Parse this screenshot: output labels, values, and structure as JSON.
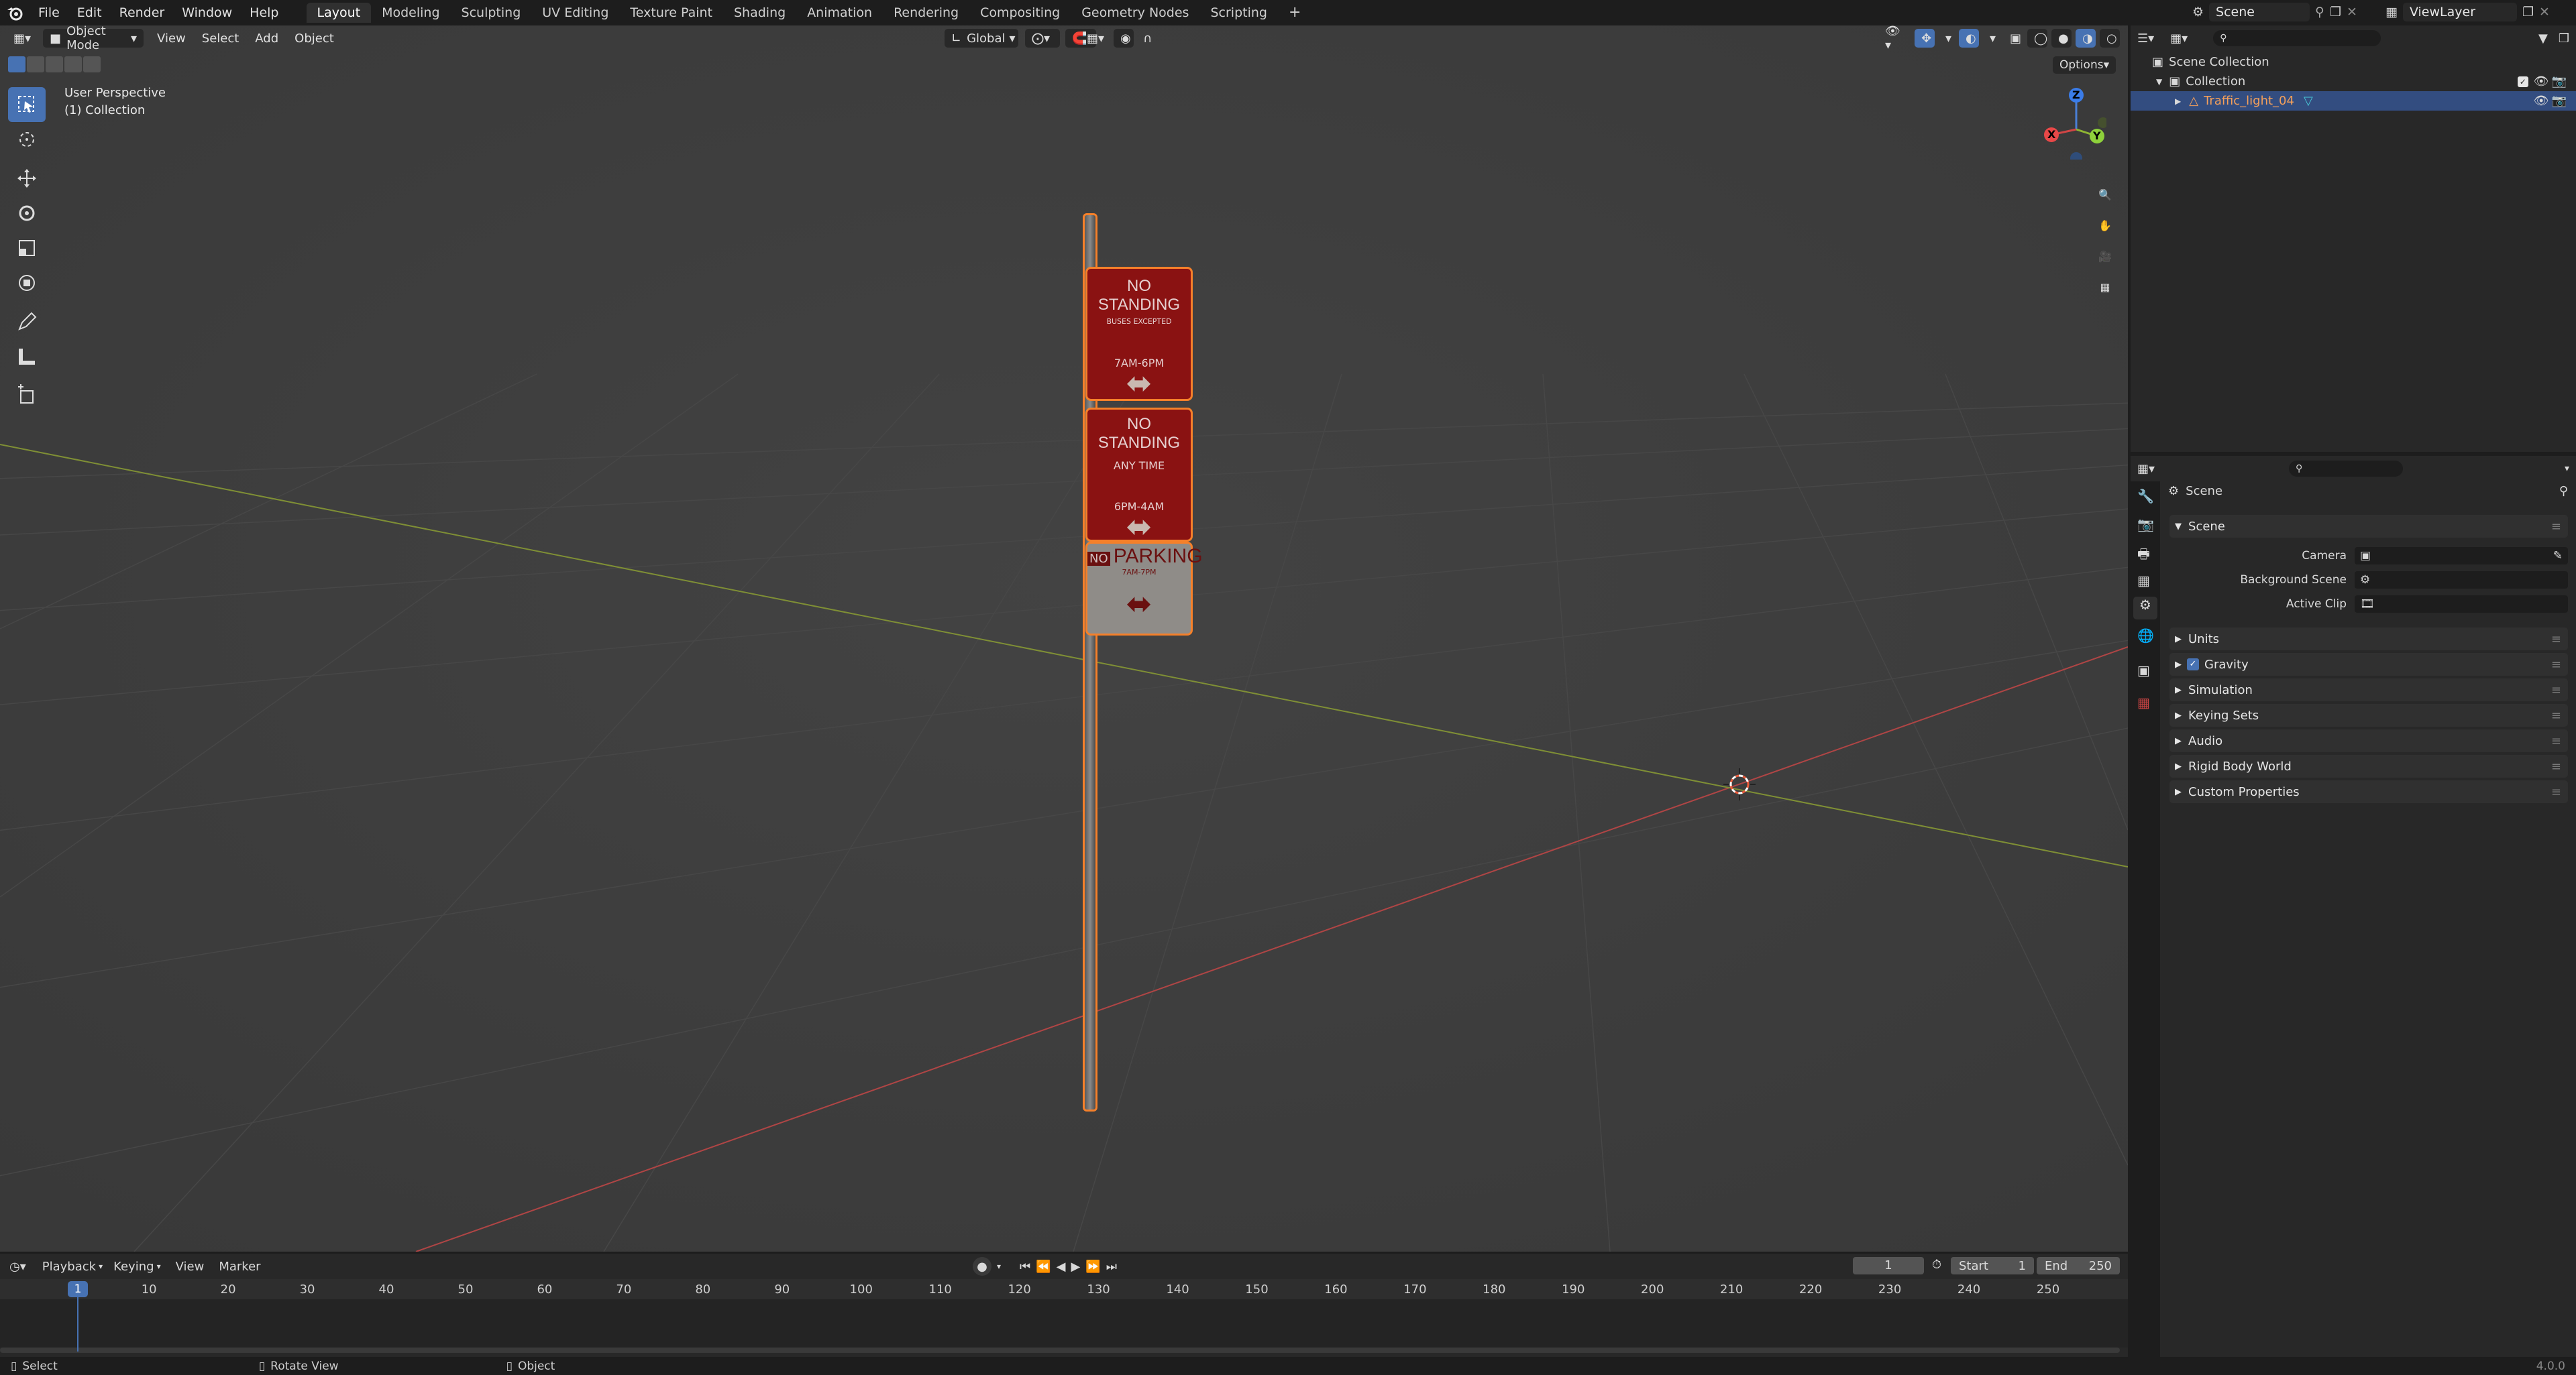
{
  "menu": [
    "File",
    "Edit",
    "Render",
    "Window",
    "Help"
  ],
  "workspaces": [
    "Layout",
    "Modeling",
    "Sculpting",
    "UV Editing",
    "Texture Paint",
    "Shading",
    "Animation",
    "Rendering",
    "Compositing",
    "Geometry Nodes",
    "Scripting"
  ],
  "active_workspace": "Layout",
  "scene_name": "Scene",
  "view_layer": "ViewLayer",
  "viewport": {
    "mode": "Object Mode",
    "menus": [
      "View",
      "Select",
      "Add",
      "Object"
    ],
    "orientation": "Global",
    "options_label": "Options",
    "overlay_line1": "User Perspective",
    "overlay_line2": "(1) Collection",
    "gizmo": {
      "x": "X",
      "y": "Y",
      "z": "Z"
    }
  },
  "signs": {
    "top": {
      "title": "NO STANDING",
      "sub": "BUSES EXCEPTED",
      "time": "7AM-6PM"
    },
    "mid": {
      "title": "NO STANDING",
      "sub": "ANY TIME",
      "time": "6PM-4AM"
    },
    "bottom": {
      "prefix": "NO",
      "title": "PARKING",
      "sub": "7AM-7PM"
    }
  },
  "outliner": {
    "root": "Scene Collection",
    "collection": "Collection",
    "object": "Traffic_light_04"
  },
  "properties": {
    "context": "Scene",
    "panel_title": "Scene",
    "fields": [
      {
        "label": "Camera"
      },
      {
        "label": "Background Scene"
      },
      {
        "label": "Active Clip"
      }
    ],
    "panels": [
      "Units",
      "Gravity",
      "Simulation",
      "Keying Sets",
      "Audio",
      "Rigid Body World",
      "Custom Properties"
    ],
    "gravity_checked": true
  },
  "timeline": {
    "menus": [
      "Playback",
      "Keying",
      "View",
      "Marker"
    ],
    "current_frame": "1",
    "start_label": "Start",
    "start": "1",
    "end_label": "End",
    "end": "250",
    "ticks": [
      "1",
      "10",
      "20",
      "30",
      "40",
      "50",
      "60",
      "70",
      "80",
      "90",
      "100",
      "110",
      "120",
      "130",
      "140",
      "150",
      "160",
      "170",
      "180",
      "190",
      "200",
      "210",
      "220",
      "230",
      "240",
      "250"
    ]
  },
  "status": {
    "select": "Select",
    "rotate": "Rotate View",
    "object": "Object",
    "version": "4.0.0"
  },
  "colors": {
    "accent": "#4772b3",
    "selection": "#f5802a",
    "sign_red": "#8a1212",
    "x_axis": "#c84545",
    "y_axis": "#8ea23a"
  }
}
